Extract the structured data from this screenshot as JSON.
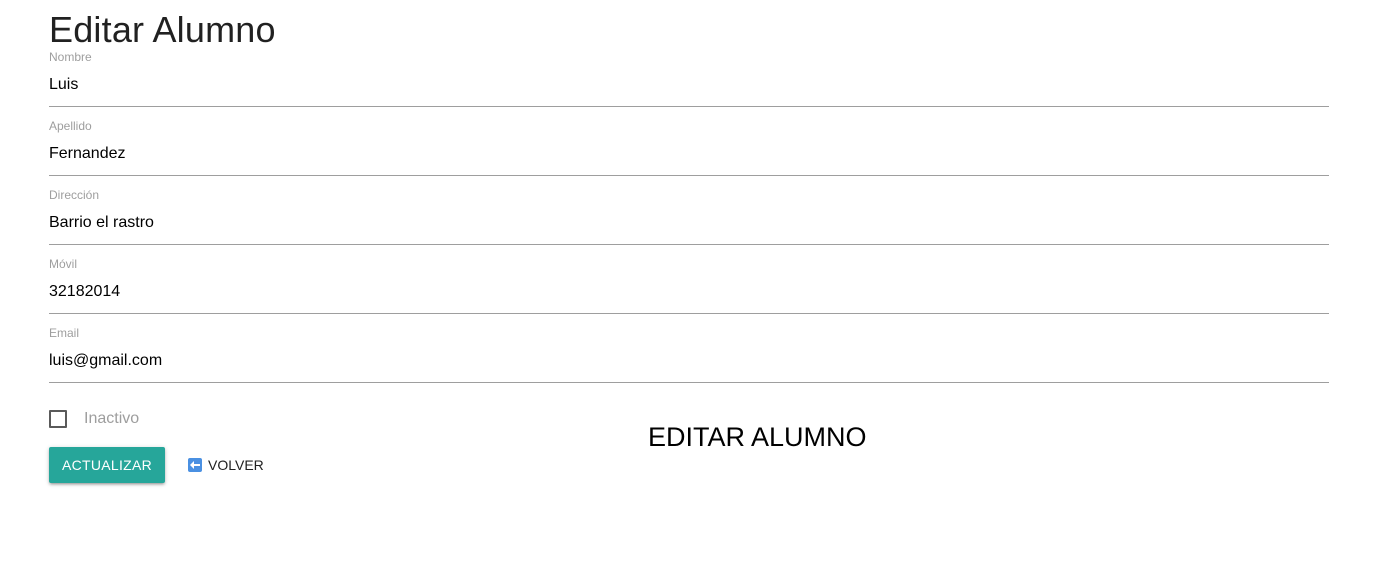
{
  "page": {
    "title": "Editar Alumno",
    "heading_center": "EDITAR ALUMNO"
  },
  "form": {
    "fields": [
      {
        "label": "Nombre",
        "value": "Luis"
      },
      {
        "label": "Apellido",
        "value": "Fernandez"
      },
      {
        "label": "Dirección",
        "value": "Barrio el rastro"
      },
      {
        "label": "Móvil",
        "value": "32182014"
      },
      {
        "label": "Email",
        "value": "luis@gmail.com"
      }
    ],
    "inactive_checkbox": {
      "label": "Inactivo",
      "checked": false
    },
    "update_button_label": "ACTUALIZAR",
    "back_link_label": "VOLVER",
    "back_icon": "arrow-left-icon"
  },
  "colors": {
    "accent": "#26a69a",
    "label": "#9e9e9e",
    "underline": "#9e9e9e",
    "back_icon": "#4a90e2"
  }
}
